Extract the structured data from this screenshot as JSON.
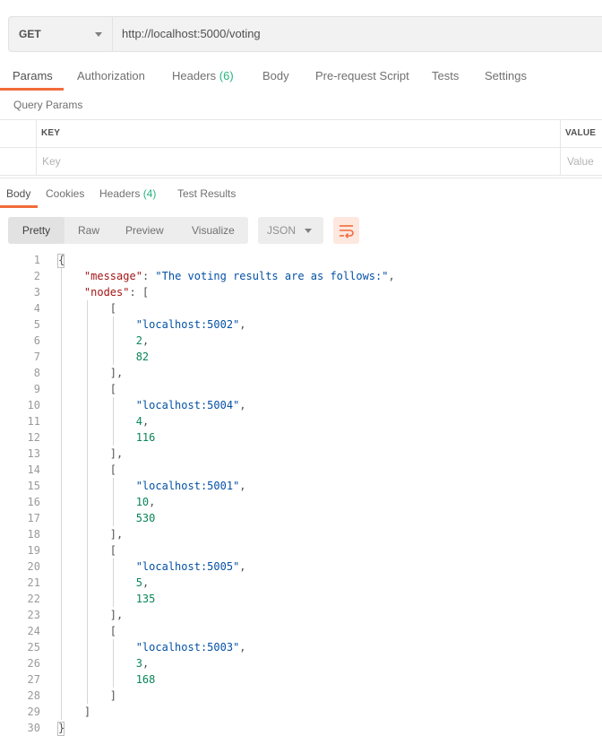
{
  "request": {
    "method": "GET",
    "url": "http://localhost:5000/voting"
  },
  "request_tabs": [
    {
      "label": "Params",
      "active": true
    },
    {
      "label": "Authorization"
    },
    {
      "label": "Headers",
      "count": "(6)"
    },
    {
      "label": "Body"
    },
    {
      "label": "Pre-request Script"
    },
    {
      "label": "Tests"
    },
    {
      "label": "Settings"
    }
  ],
  "query_params": {
    "title": "Query Params",
    "key_header": "KEY",
    "value_header": "VALUE",
    "key_placeholder": "Key",
    "value_placeholder": "Value"
  },
  "response_tabs": [
    {
      "label": "Body",
      "active": true
    },
    {
      "label": "Cookies"
    },
    {
      "label": "Headers",
      "count": "(4)"
    },
    {
      "label": "Test Results"
    }
  ],
  "format_options": [
    {
      "label": "Pretty",
      "active": true
    },
    {
      "label": "Raw"
    },
    {
      "label": "Preview"
    },
    {
      "label": "Visualize"
    }
  ],
  "language": "JSON",
  "response_json": {
    "message_key": "\"message\"",
    "message_value": "\"The voting results are as follows:\"",
    "nodes_key": "\"nodes\"",
    "nodes": [
      {
        "host": "\"localhost:5002\"",
        "votes": "2",
        "value": "82"
      },
      {
        "host": "\"localhost:5004\"",
        "votes": "4",
        "value": "116"
      },
      {
        "host": "\"localhost:5001\"",
        "votes": "10",
        "value": "530"
      },
      {
        "host": "\"localhost:5005\"",
        "votes": "5",
        "value": "135"
      },
      {
        "host": "\"localhost:5003\"",
        "votes": "3",
        "value": "168"
      }
    ]
  },
  "line_numbers": [
    "1",
    "2",
    "3",
    "4",
    "5",
    "6",
    "7",
    "8",
    "9",
    "10",
    "11",
    "12",
    "13",
    "14",
    "15",
    "16",
    "17",
    "18",
    "19",
    "20",
    "21",
    "22",
    "23",
    "24",
    "25",
    "26",
    "27",
    "28",
    "29",
    "30"
  ],
  "colors": {
    "accent": "#f26b3a",
    "count": "#26b47f",
    "json_key": "#a31515",
    "json_string": "#0451a5",
    "json_number": "#098658"
  }
}
